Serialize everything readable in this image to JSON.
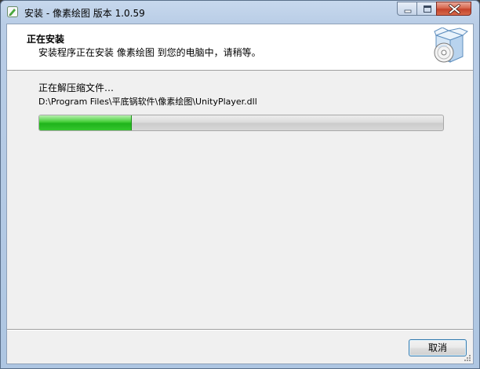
{
  "window": {
    "title": "安装 - 像素绘图 版本 1.0.59"
  },
  "header": {
    "title": "正在安装",
    "subtitle": "安装程序正在安装 像素绘图 到您的电脑中，请稍等。"
  },
  "main": {
    "status_text": "正在解压缩文件…",
    "current_file": "D:\\Program Files\\平底锅软件\\像素绘图\\UnityPlayer.dll",
    "progress_fraction": 0.23
  },
  "footer": {
    "cancel_label": "取消"
  },
  "colors": {
    "progress_fill": "#2cc125",
    "titlebar": "#b9cde6",
    "close_button": "#c4422a"
  },
  "icons": [
    "app-icon",
    "minimize-icon",
    "maximize-icon",
    "close-icon",
    "install-box-icon",
    "resize-grip-icon"
  ]
}
